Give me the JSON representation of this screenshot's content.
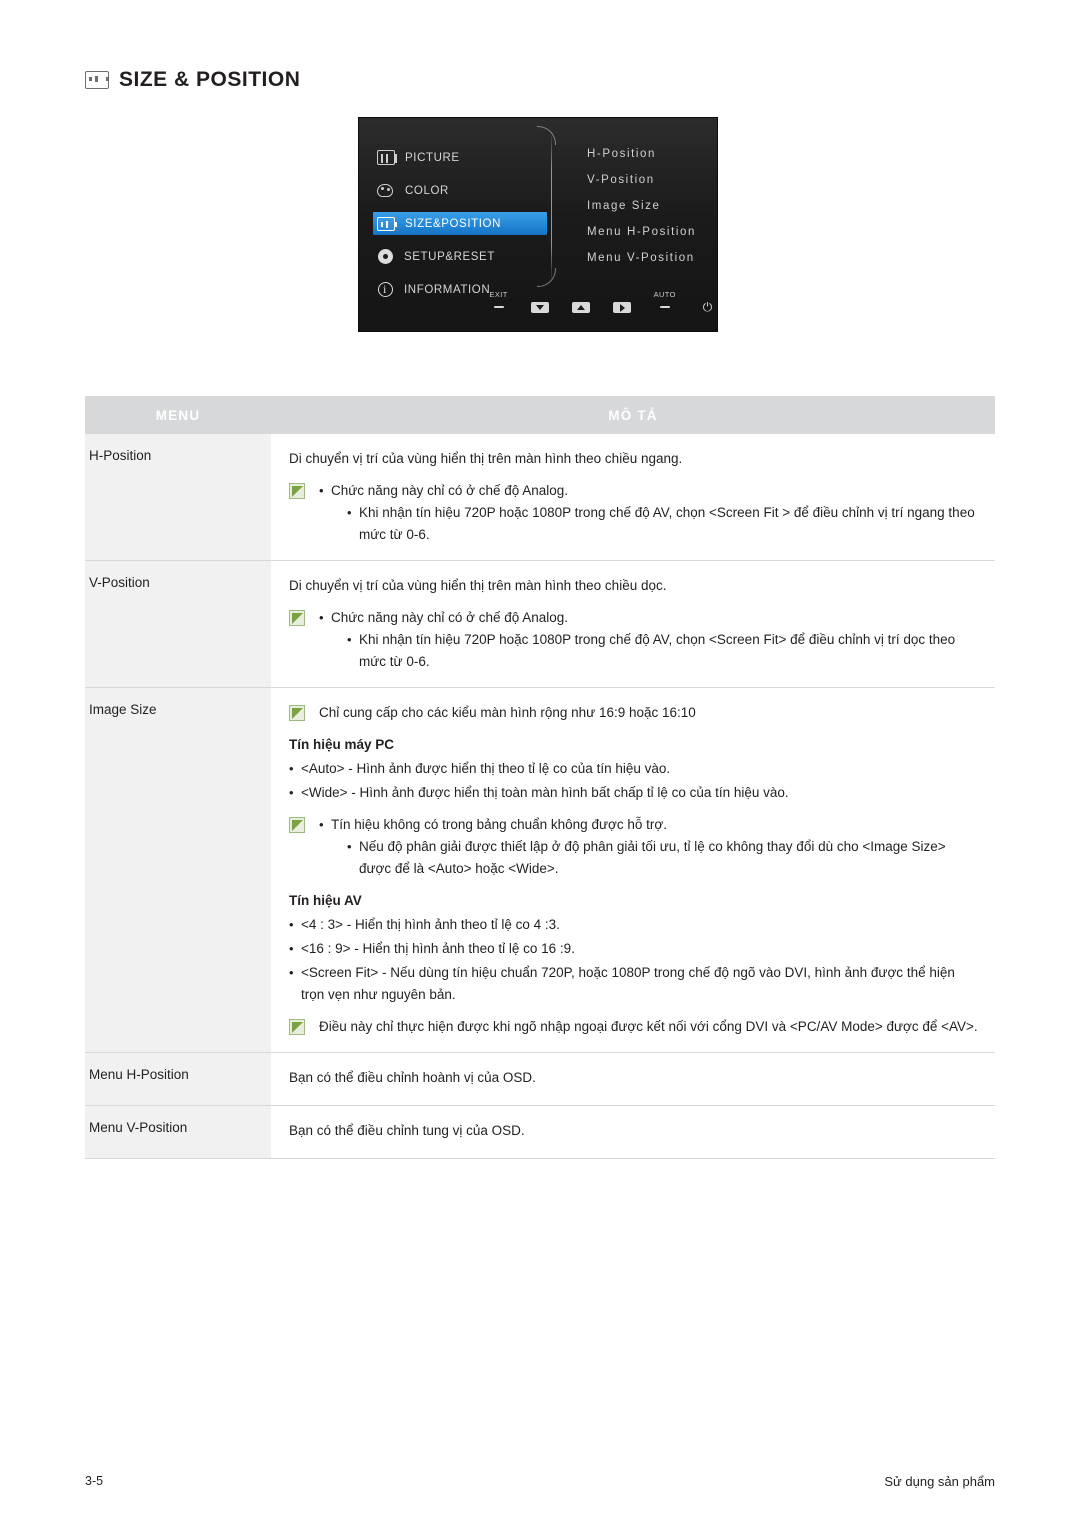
{
  "heading": {
    "icon": "size-position-icon",
    "title": "SIZE & POSITION"
  },
  "osd": {
    "menu_items": [
      {
        "label": "PICTURE",
        "icon": "picture-icon",
        "selected": false
      },
      {
        "label": "COLOR",
        "icon": "color-icon",
        "selected": false
      },
      {
        "label": "SIZE&POSITION",
        "icon": "size-position-icon",
        "selected": true
      },
      {
        "label": "SETUP&RESET",
        "icon": "gear-icon",
        "selected": false
      },
      {
        "label": "INFORMATION",
        "icon": "info-icon",
        "selected": false
      }
    ],
    "submenu_items": [
      "H-Position",
      "V-Position",
      "Image Size",
      "Menu H-Position",
      "Menu V-Position"
    ],
    "buttons": [
      {
        "label": "EXIT",
        "key": "dash"
      },
      {
        "label": "",
        "key": "arrow-down"
      },
      {
        "label": "",
        "key": "arrow-up"
      },
      {
        "label": "",
        "key": "arrow-right"
      },
      {
        "label": "AUTO",
        "key": "dash"
      },
      {
        "label": "",
        "key": "power"
      }
    ]
  },
  "table": {
    "headers": {
      "menu": "MENU",
      "desc": "MÔ TẢ"
    },
    "rows": [
      {
        "menu": "H-Position",
        "blocks": [
          {
            "type": "text",
            "text": "Di chuyển vị trí của vùng hiển thị trên màn hình theo chiều ngang."
          },
          {
            "type": "note",
            "items": [
              {
                "indent": 0,
                "text": "Chức năng này chỉ có ở chế độ Analog."
              },
              {
                "indent": 1,
                "text": "Khi nhận tín hiệu 720P hoặc 1080P trong chế độ AV, chọn <Screen Fit > để điều chỉnh vị trí ngang theo mức từ 0-6."
              }
            ]
          }
        ]
      },
      {
        "menu": "V-Position",
        "blocks": [
          {
            "type": "text",
            "text": "Di chuyển vị trí của vùng hiển thị trên màn hình theo chiều dọc."
          },
          {
            "type": "note",
            "items": [
              {
                "indent": 0,
                "text": "Chức năng này chỉ có ở chế độ Analog."
              },
              {
                "indent": 1,
                "text": "Khi nhận tín hiệu 720P hoặc 1080P trong chế độ AV, chọn <Screen Fit> để điều chỉnh vị trí dọc theo mức từ 0-6."
              }
            ]
          }
        ]
      },
      {
        "menu": "Image Size",
        "blocks": [
          {
            "type": "note",
            "items": [
              {
                "indent": -1,
                "text": "Chỉ cung cấp cho các kiểu màn hình rộng như 16:9 hoặc 16:10"
              }
            ]
          },
          {
            "type": "heading",
            "text": "Tín hiệu máy PC"
          },
          {
            "type": "bullet",
            "text": "<Auto> - Hình ảnh được hiển thị theo tỉ lệ co của tín hiệu vào."
          },
          {
            "type": "bullet",
            "text": "<Wide> - Hình ảnh được hiển thị toàn màn hình bất chấp tỉ lệ co của tín hiệu vào."
          },
          {
            "type": "note",
            "items": [
              {
                "indent": 0,
                "text": "Tín hiệu không có trong bảng chuẩn không được hỗ trợ."
              },
              {
                "indent": 1,
                "text": "Nếu độ phân giải được thiết lập ở độ phân giải tối ưu, tỉ lệ co không thay đổi dù cho <Image Size> được để là <Auto> hoặc <Wide>."
              }
            ]
          },
          {
            "type": "heading",
            "text": "Tín hiệu AV"
          },
          {
            "type": "bullet",
            "text": "<4 : 3> - Hiển thị hình ảnh theo tỉ lệ co 4 :3."
          },
          {
            "type": "bullet",
            "text": "<16 : 9> - Hiển thị hình ảnh theo tỉ lệ co 16 :9."
          },
          {
            "type": "bullet",
            "text": "<Screen Fit> - Nếu dùng tín hiệu chuẩn 720P, hoặc 1080P trong chế độ ngõ vào DVI, hình ảnh được thể hiện trọn vẹn như nguyên bản."
          },
          {
            "type": "note",
            "items": [
              {
                "indent": -1,
                "text": "Điều này chỉ thực hiện được khi ngõ nhập ngoại được kết nối với cổng DVI và <PC/AV Mode> được để <AV>."
              }
            ]
          }
        ]
      },
      {
        "menu": "Menu H-Position",
        "blocks": [
          {
            "type": "text",
            "text": "Bạn có thể điều chỉnh hoành vị của OSD."
          }
        ]
      },
      {
        "menu": "Menu V-Position",
        "blocks": [
          {
            "type": "text",
            "text": "Bạn có thể điều chỉnh tung vị của OSD."
          }
        ]
      }
    ]
  },
  "footer": {
    "page_number": "3-5",
    "section": "Sử dụng sản phẩm"
  }
}
